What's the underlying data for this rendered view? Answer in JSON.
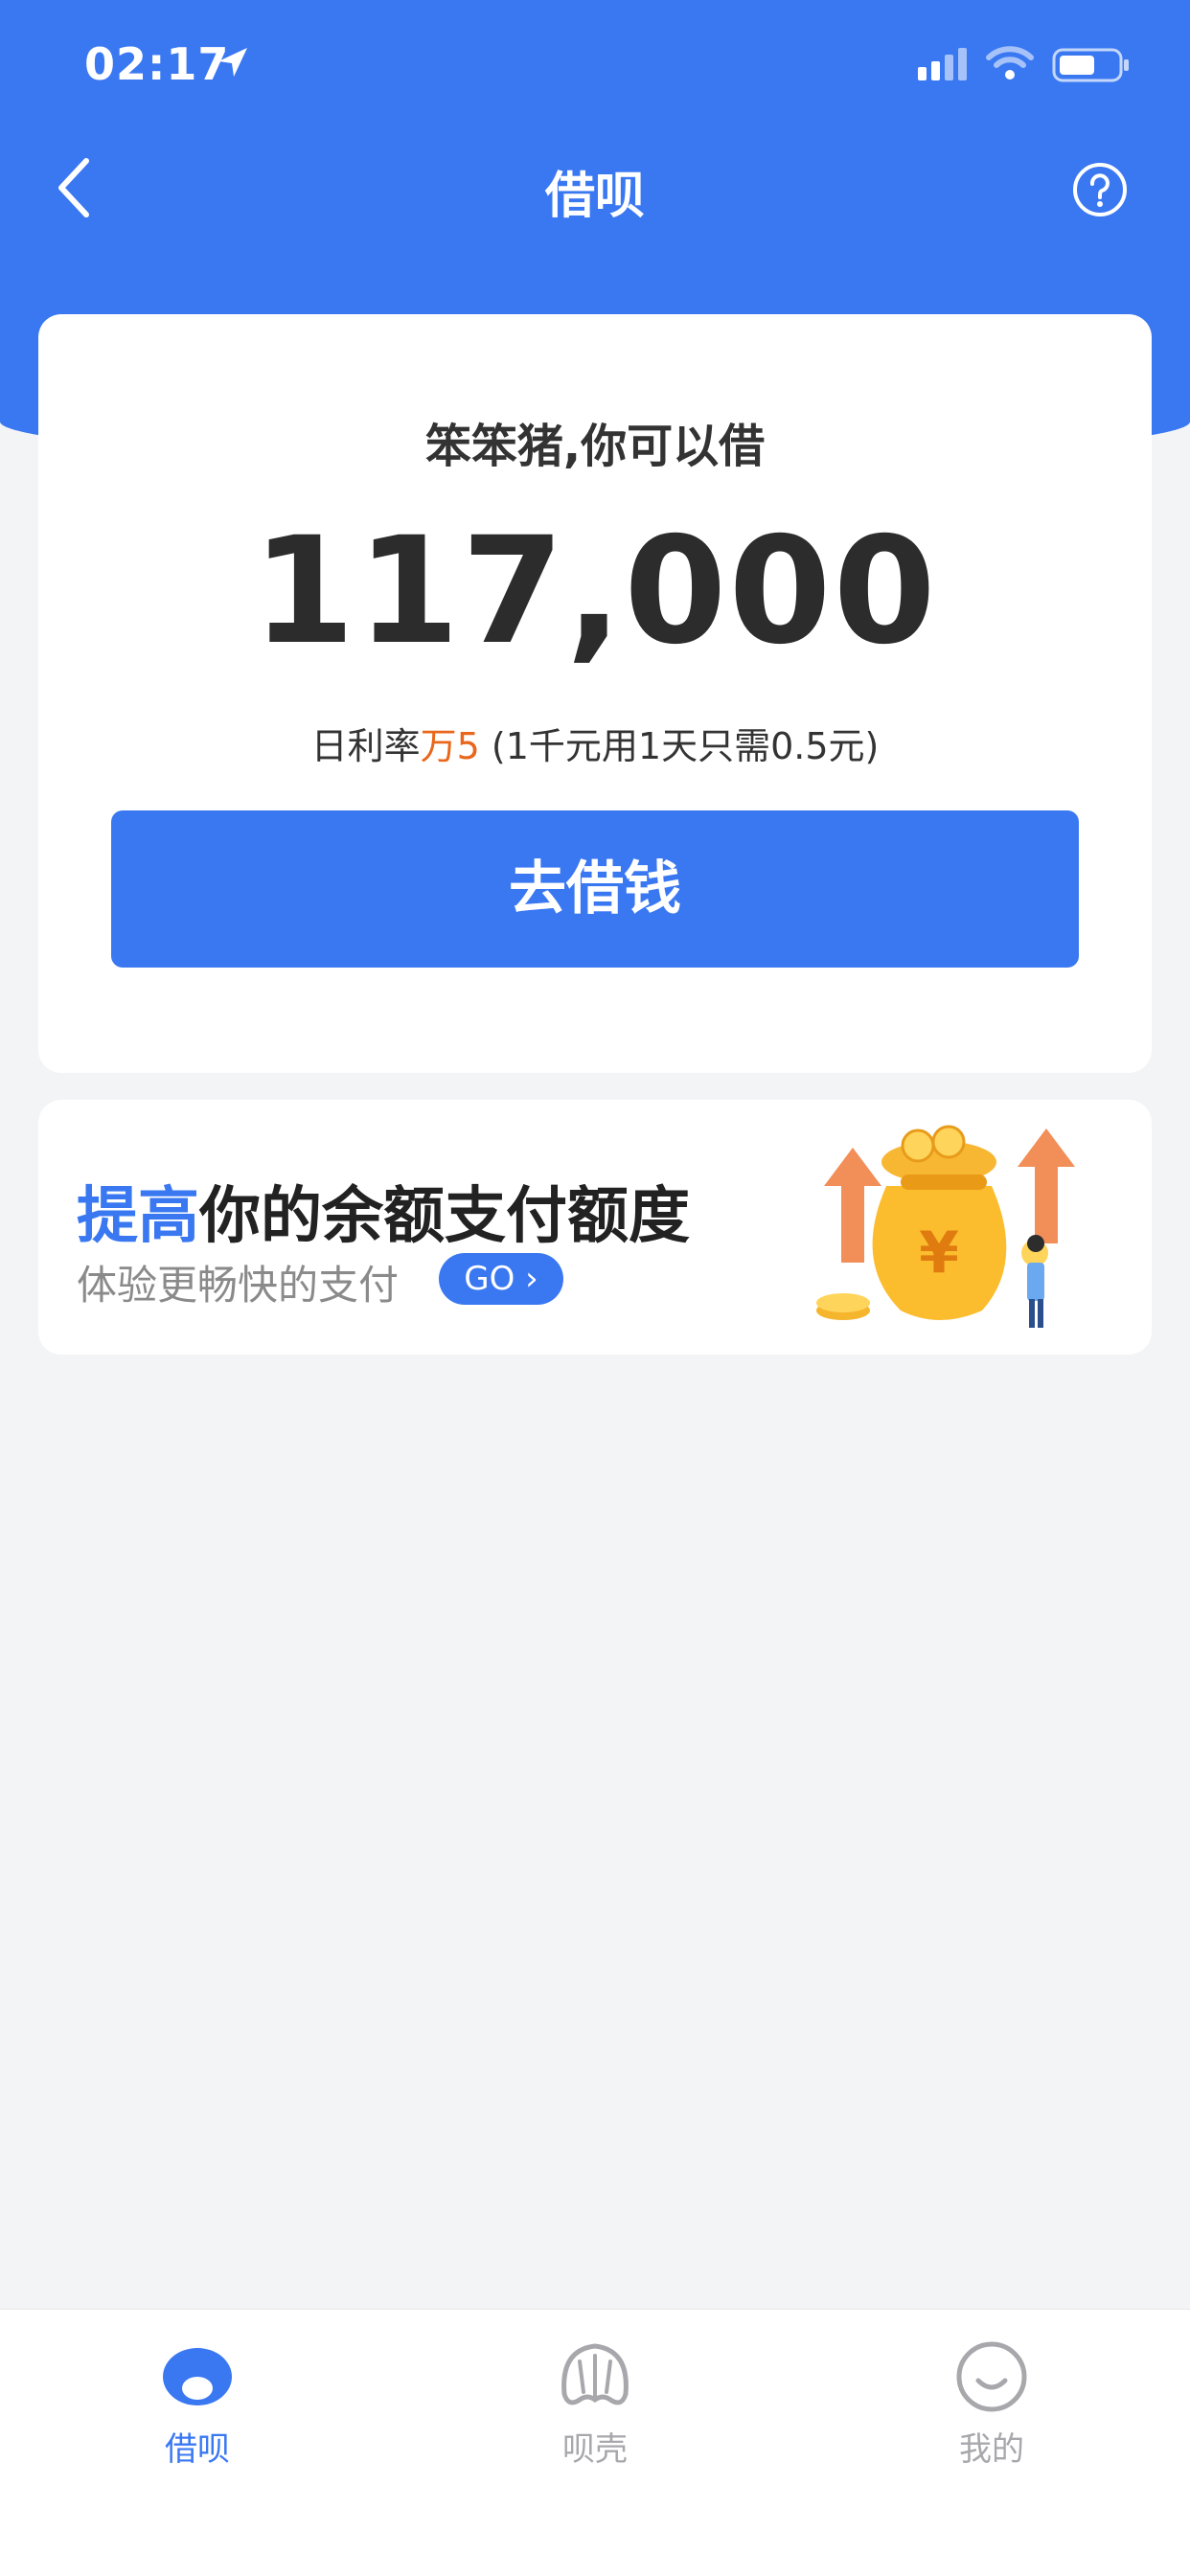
{
  "status_bar": {
    "time": "02:17"
  },
  "header": {
    "title": "借呗"
  },
  "loan_card": {
    "greeting": "笨笨猪,你可以借",
    "amount": "117,000",
    "rate_prefix": "日利率",
    "rate_highlight": "万5",
    "rate_suffix": " (1千元用1天只需0.5元)",
    "borrow_button": "去借钱"
  },
  "promo": {
    "title_highlight": "提高",
    "title_rest": "你的余额支付额度",
    "subtitle": "体验更畅快的支付",
    "go_label": "GO"
  },
  "tabs": [
    {
      "label": "借呗",
      "icon": "jiebei-icon",
      "active": true
    },
    {
      "label": "呗壳",
      "icon": "shell-icon",
      "active": false
    },
    {
      "label": "我的",
      "icon": "smiley-icon",
      "active": false
    }
  ],
  "colors": {
    "primary": "#3a78f2",
    "accent_orange": "#e8671b",
    "background": "#f3f4f6"
  }
}
